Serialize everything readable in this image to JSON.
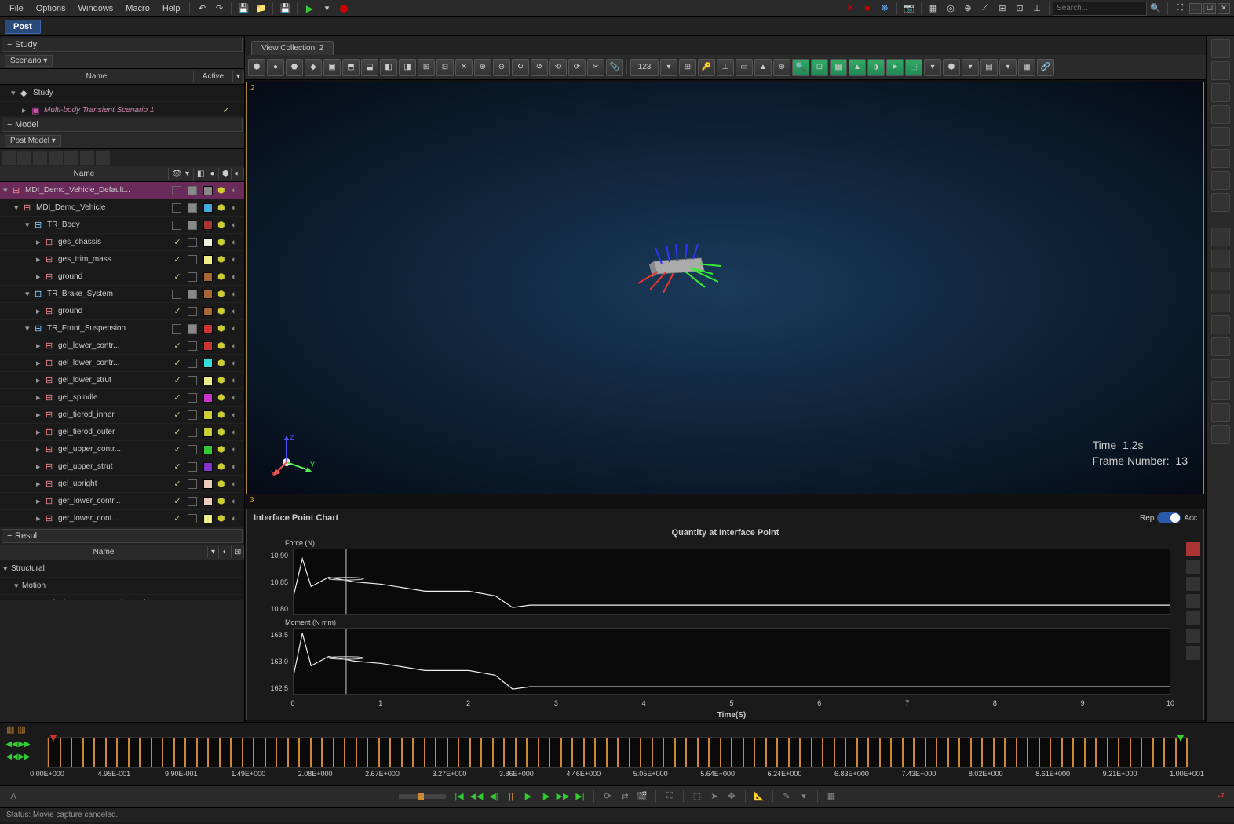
{
  "menu": {
    "items": [
      "File",
      "Options",
      "Windows",
      "Macro",
      "Help"
    ]
  },
  "search_placeholder": "Search...",
  "post_tab": "Post",
  "panels": {
    "study": {
      "title": "Study",
      "scenario_label": "Scenario",
      "columns": [
        "Name",
        "Active"
      ],
      "rows": [
        {
          "label": "Study",
          "indent": 1,
          "type": "study"
        },
        {
          "label": "Multi-body Transient Scenario 1",
          "indent": 2,
          "type": "scenario",
          "active": true,
          "italic": true
        }
      ]
    },
    "model": {
      "title": "Model",
      "sub_label": "Post Model",
      "name_col": "Name",
      "rows": [
        {
          "label": "MDI_Demo_Vehicle_Default...",
          "indent": 0,
          "selected": true,
          "color": "#888",
          "check": "box"
        },
        {
          "label": "MDI_Demo_Vehicle",
          "indent": 1,
          "color": "#4ad",
          "check": "box"
        },
        {
          "label": "TR_Body",
          "indent": 2,
          "color": "#a33",
          "check": "box",
          "group": true
        },
        {
          "label": "ges_chassis",
          "indent": 3,
          "color": "#eed",
          "check": "v"
        },
        {
          "label": "ges_trim_mass",
          "indent": 3,
          "color": "#ee8",
          "check": "v"
        },
        {
          "label": "ground",
          "indent": 3,
          "color": "#a63",
          "check": "v"
        },
        {
          "label": "TR_Brake_System",
          "indent": 2,
          "color": "#a63",
          "check": "box",
          "group": true
        },
        {
          "label": "ground",
          "indent": 3,
          "color": "#a63",
          "check": "v"
        },
        {
          "label": "TR_Front_Suspension",
          "indent": 2,
          "color": "#c33",
          "check": "box",
          "group": true
        },
        {
          "label": "gel_lower_contr...",
          "indent": 3,
          "color": "#c33",
          "check": "v"
        },
        {
          "label": "gel_lower_contr...",
          "indent": 3,
          "color": "#3dd",
          "check": "v"
        },
        {
          "label": "gel_lower_strut",
          "indent": 3,
          "color": "#ee8",
          "check": "v"
        },
        {
          "label": "gel_spindle",
          "indent": 3,
          "color": "#c3c",
          "check": "v"
        },
        {
          "label": "gel_tierod_inner",
          "indent": 3,
          "color": "#cc3",
          "check": "v"
        },
        {
          "label": "gel_tierod_outer",
          "indent": 3,
          "color": "#cc3",
          "check": "v"
        },
        {
          "label": "gel_upper_contr...",
          "indent": 3,
          "color": "#3c3",
          "check": "v"
        },
        {
          "label": "gel_upper_strut",
          "indent": 3,
          "color": "#83c",
          "check": "v"
        },
        {
          "label": "gel_upright",
          "indent": 3,
          "color": "#ecb",
          "check": "v"
        },
        {
          "label": "ger_lower_contr...",
          "indent": 3,
          "color": "#ecb",
          "check": "v"
        },
        {
          "label": "ger_lower_cont...",
          "indent": 3,
          "color": "#ee8",
          "check": "v"
        }
      ]
    },
    "result": {
      "title": "Result",
      "name_col": "Name",
      "rows": [
        {
          "label": "Structural",
          "indent": 0
        },
        {
          "label": "Motion",
          "indent": 1
        },
        {
          "label": "Displacements Translational",
          "indent": 2
        }
      ]
    }
  },
  "view_tab": "View Collection: 2",
  "viewport": {
    "label": "2",
    "time_label": "Time",
    "time_value": "1.2s",
    "frame_label": "Frame Number:",
    "frame_value": "13",
    "triad": {
      "x": "X",
      "y": "Y",
      "z": "Z"
    }
  },
  "chart": {
    "panel_label": "3",
    "header_title": "Interface Point Chart",
    "rep_label": "Rep",
    "acc_label": "Acc",
    "title": "Quantity at Interface Point",
    "xlabel": "Time(S)",
    "x_ticks": [
      "0",
      "1",
      "2",
      "3",
      "4",
      "5",
      "6",
      "7",
      "8",
      "9",
      "10"
    ],
    "force": {
      "label": "Force (N)",
      "ticks": [
        "10.90",
        "10.85",
        "10.80"
      ]
    },
    "moment": {
      "label": "Moment (N mm)",
      "ticks": [
        "163.5",
        "163.0",
        "162.5"
      ]
    }
  },
  "chart_data": [
    {
      "type": "line",
      "title": "Quantity at Interface Point",
      "xlabel": "Time(S)",
      "ylabel": "Force (N)",
      "ylim": [
        10.78,
        10.92
      ],
      "xlim": [
        0,
        10
      ],
      "series": [
        {
          "name": "Force",
          "x": [
            0,
            0.1,
            0.2,
            0.4,
            0.7,
            1.0,
            1.5,
            2.0,
            2.3,
            2.5,
            2.7,
            3.0,
            4.0,
            6.0,
            8.0,
            10.0
          ],
          "y": [
            10.82,
            10.9,
            10.84,
            10.86,
            10.85,
            10.845,
            10.83,
            10.83,
            10.82,
            10.795,
            10.8,
            10.8,
            10.8,
            10.8,
            10.8,
            10.8
          ]
        }
      ],
      "cursor_x": 0.6
    },
    {
      "type": "line",
      "xlabel": "Time(S)",
      "ylabel": "Moment (N mm)",
      "ylim": [
        162.3,
        163.7
      ],
      "xlim": [
        0,
        10
      ],
      "series": [
        {
          "name": "Moment",
          "x": [
            0,
            0.1,
            0.2,
            0.4,
            0.7,
            1.0,
            1.5,
            2.0,
            2.3,
            2.5,
            2.7,
            3.0,
            4.0,
            6.0,
            8.0,
            10.0
          ],
          "y": [
            162.7,
            163.6,
            162.9,
            163.1,
            163.0,
            162.95,
            162.8,
            162.8,
            162.7,
            162.4,
            162.45,
            162.45,
            162.45,
            162.45,
            162.45,
            162.45
          ]
        }
      ],
      "cursor_x": 0.6
    }
  ],
  "timeline": {
    "labels": [
      "0.00E+000",
      "4.95E-001",
      "9.90E-001",
      "1.49E+000",
      "2.08E+000",
      "2.67E+000",
      "3.27E+000",
      "3.86E+000",
      "4.46E+000",
      "5.05E+000",
      "5.64E+000",
      "6.24E+000",
      "6.83E+000",
      "7.43E+000",
      "8.02E+000",
      "8.61E+000",
      "9.21E+000",
      "1.00E+001"
    ]
  },
  "center_toolbar_text": "123",
  "status": "Status:  Movie capture canceled."
}
